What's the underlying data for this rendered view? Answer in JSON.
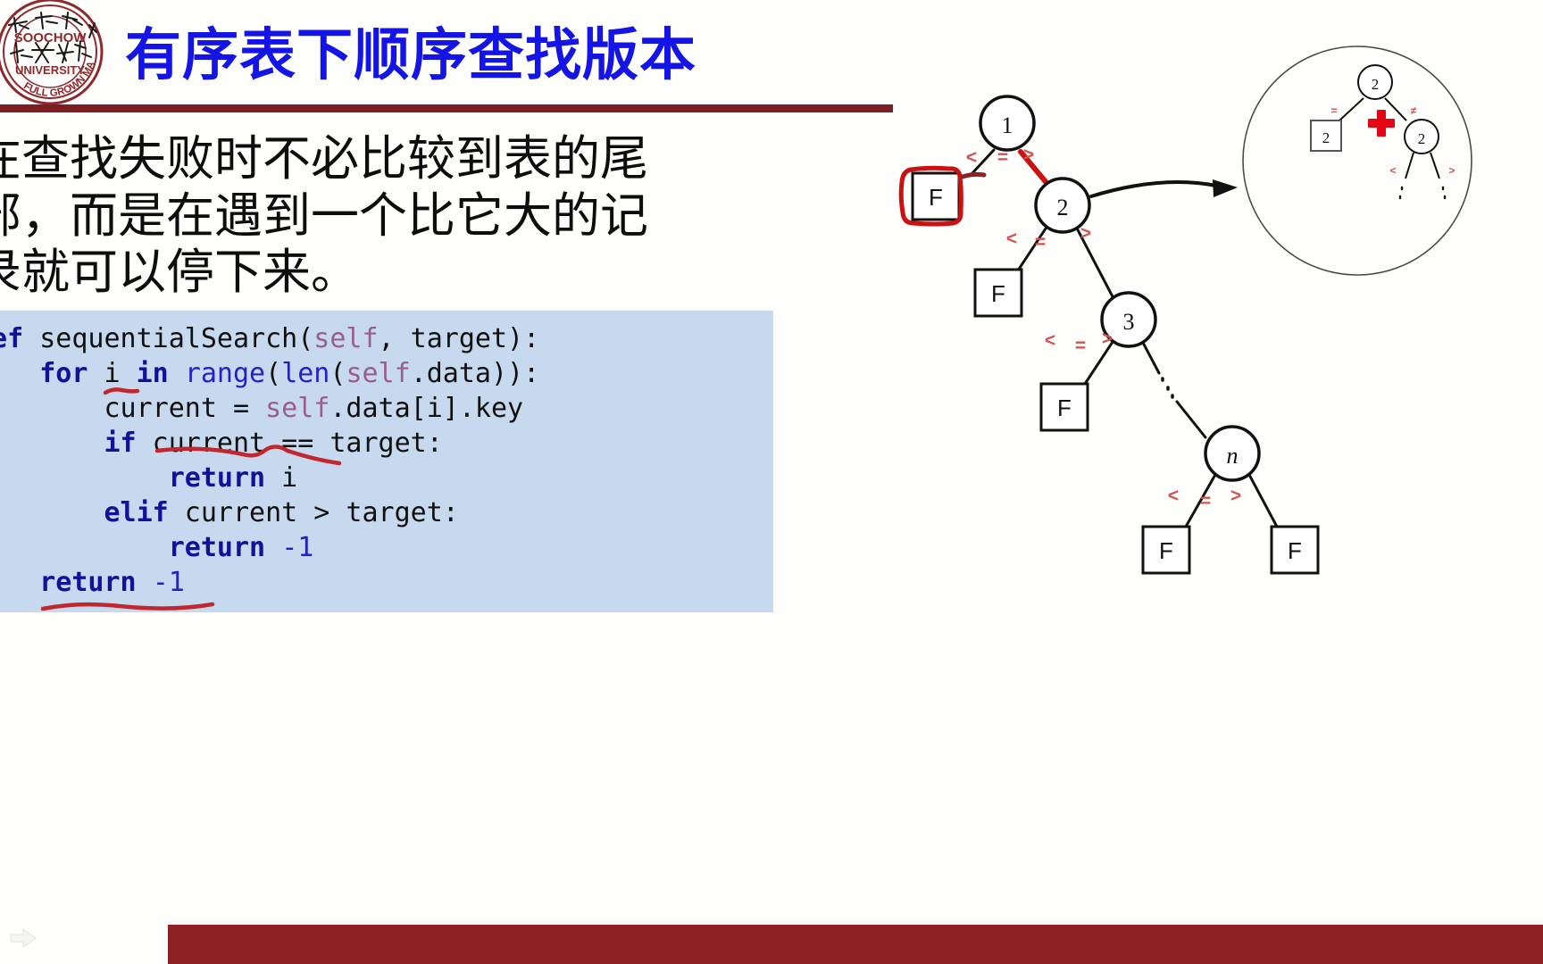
{
  "slide": {
    "title": "有序表下顺序查找版本",
    "body_paragraph": "在查找失败时不必比较到表的尾\n部，而是在遇到一个比它大的记\n录就可以停下来。",
    "logo": {
      "name": "soochow-university-seal",
      "text_outer_top": "SOOCHOW",
      "text_outer_mid": "UNIVERSITY",
      "text_outer_bottom": "FULL GROWN MAN",
      "color": "#8e2a2d"
    },
    "accent_color": "#7b1f22",
    "title_color": "#1414e6"
  },
  "code": {
    "background": "#c7d9ef",
    "language": "python",
    "lines": [
      "def sequentialSearch(self, target):",
      "    for i in range(len(self.data)):",
      "        current = self.data[i].key",
      "        if current == target:",
      "            return i",
      "        elif current > target:",
      "            return -1",
      "    return -1"
    ],
    "annotations": [
      {
        "name": "underline-in-keyword",
        "note": "red underline under 'in'"
      },
      {
        "name": "underline-if-condition",
        "note": "red underline under 'current == target'"
      },
      {
        "name": "underline-final-return",
        "note": "red underline under final 'return -1'"
      }
    ]
  },
  "tree": {
    "caption": "binary search decision tree",
    "nodes": [
      {
        "id": "n1",
        "label": "1",
        "shape": "circle"
      },
      {
        "id": "n2",
        "label": "2",
        "shape": "circle"
      },
      {
        "id": "n3",
        "label": "3",
        "shape": "circle"
      },
      {
        "id": "nn",
        "label": "n",
        "shape": "circle",
        "italic": true
      },
      {
        "id": "f1",
        "label": "F",
        "shape": "square",
        "highlighted": true
      },
      {
        "id": "f2",
        "label": "F",
        "shape": "square"
      },
      {
        "id": "f3",
        "label": "F",
        "shape": "square"
      },
      {
        "id": "f4",
        "label": "F",
        "shape": "square"
      },
      {
        "id": "f5",
        "label": "F",
        "shape": "square"
      }
    ],
    "edge_labels": [
      "<",
      "=",
      ">"
    ],
    "edge_label_color": "#d4524f",
    "highlight_color": "#cc1111",
    "inset": {
      "name": "magnifier-inset",
      "nodes": [
        {
          "label": "2",
          "shape": "circle"
        },
        {
          "label": "2",
          "shape": "square"
        },
        {
          "label": "2",
          "shape": "circle"
        }
      ],
      "edge_labels": [
        "=",
        "≠",
        "<",
        ">"
      ],
      "marker": "red-cross"
    }
  },
  "bottom": {
    "bar_color": "#8e2123",
    "cursor_icon": "pointer-arrow-icon"
  }
}
